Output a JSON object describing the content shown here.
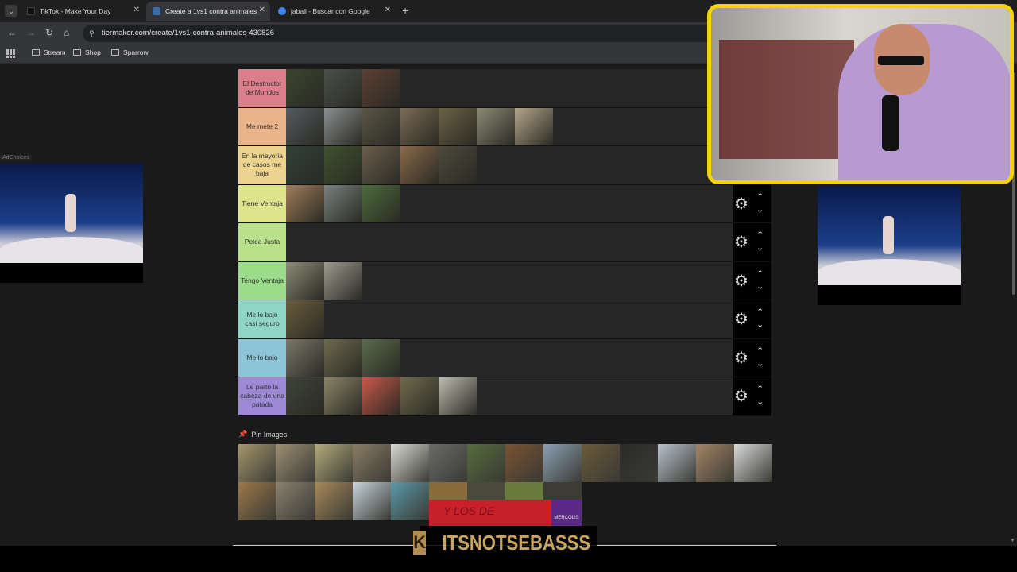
{
  "browser": {
    "tabs": [
      {
        "title": "TikTok - Make Your Day",
        "fav_color": "#111111"
      },
      {
        "title": "Create a 1vs1 contra animales",
        "fav_color": "#3b6ea5"
      },
      {
        "title": "jabali - Buscar con Google",
        "fav_color": "#4285f4"
      }
    ],
    "url": "tiermaker.com/create/1vs1-contra-animales-430826",
    "bookmarks": [
      "Stream",
      "Shop",
      "Sparrow"
    ]
  },
  "tiers": [
    {
      "label": "El Destructor de Mundos",
      "color": "#d97e8a",
      "tiles": [
        "#3c4530",
        "#4b4f4a",
        "#5c3f34"
      ]
    },
    {
      "label": "Me mete 2",
      "color": "#e9b48a",
      "tiles": [
        "#545a5f",
        "#8a8e90",
        "#5a5546",
        "#7b6b56",
        "#6c6245",
        "#8b8a78",
        "#b4a58a"
      ]
    },
    {
      "label": "En la mayoria de casos me baja",
      "color": "#ecd48e",
      "tiles": [
        "#31403a",
        "#3f5230",
        "#6b5e4c",
        "#8a6a4a",
        "#4d4a3c"
      ]
    },
    {
      "label": "Tiene Ventaja",
      "color": "#dde58c",
      "tiles": [
        "#a07e5a",
        "#77807e",
        "#4d6b3c"
      ]
    },
    {
      "label": "Pelea Justa",
      "color": "#b9e18b",
      "tiles": []
    },
    {
      "label": "Tengo Ventaja",
      "color": "#9bdc8d",
      "tiles": [
        "#8c8a76",
        "#9d9a8f"
      ]
    },
    {
      "label": "Me lo bajo casi seguro",
      "color": "#8fd6c6",
      "tiles": [
        "#6a5c3c"
      ]
    },
    {
      "label": "Me lo bajo",
      "color": "#8ec4d8",
      "tiles": [
        "#7b7769",
        "#6d6a4e",
        "#5a6b4c"
      ]
    },
    {
      "label": "Le parto la cabeza de una patada",
      "color": "#9d8ad6",
      "tiles": [
        "#3f4438",
        "#8a8468",
        "#c9584a",
        "#6f6a4c",
        "#bcbcb0"
      ]
    }
  ],
  "tier_controls": {
    "gear_icon": "⚙",
    "up_icon": "⌃",
    "down_icon": "⌄"
  },
  "pin_label": "Pin Images",
  "pool_row1": [
    "#a4956d",
    "#9c8f72",
    "#b4ac7c",
    "#8a7d66",
    "#dadad4",
    "#6a6b6a",
    "#556b3c",
    "#7a5232",
    "#8ba0b4",
    "#6a5a3a",
    "#2a2a2a",
    "#b8c2cc",
    "#a48466",
    "#d8dadb"
  ],
  "pool_row2": [
    "#9c7848",
    "#8a8070",
    "#a88a5a",
    "#c8d4dc",
    "#5a9aa8"
  ],
  "pool_small": [
    "#8a6a3a",
    "#4a4a3c",
    "#6a7a3c",
    "#3c3c34",
    "#8a7a5a",
    "#6a7a5a",
    "#7a6a5a"
  ],
  "overlay": {
    "banner_text": "Y LOS DE",
    "right_text": "MERCOLIS"
  },
  "watermark": {
    "logo": "K",
    "text": "ITSNOTSEBASSS"
  },
  "ad_choice": "AdChoices"
}
